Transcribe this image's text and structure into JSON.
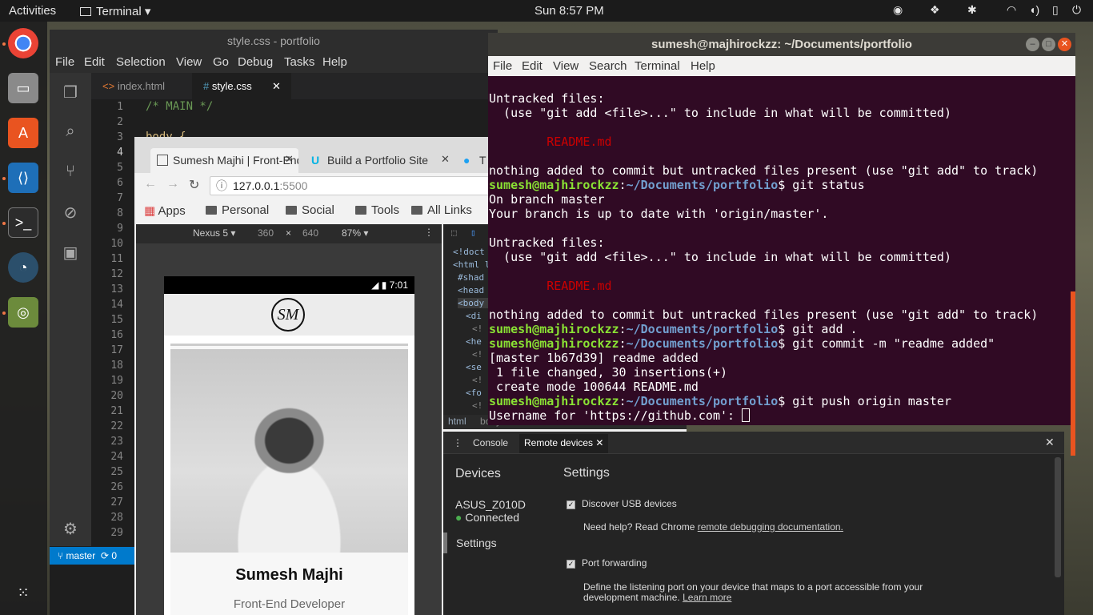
{
  "topbar": {
    "activities": "Activities",
    "app_name": "Terminal",
    "clock": "Sun  8:57 PM"
  },
  "dock": {
    "apps": [
      "chrome",
      "files",
      "software",
      "vscode",
      "terminal",
      "disk-usage",
      "image-viewer"
    ]
  },
  "vscode": {
    "title": "style.css - portfolio",
    "menu": [
      "File",
      "Edit",
      "Selection",
      "View",
      "Go",
      "Debug",
      "Tasks",
      "Help"
    ],
    "tabs": [
      {
        "label": "index.html",
        "active": false
      },
      {
        "label": "style.css",
        "active": true
      }
    ],
    "line_numbers": [
      "1",
      "2",
      "3",
      "4",
      "5",
      "6",
      "7",
      "8",
      "9",
      "10",
      "11",
      "12",
      "13",
      "14",
      "15",
      "16",
      "17",
      "18",
      "19",
      "20",
      "21",
      "22",
      "23",
      "24",
      "25",
      "26",
      "27",
      "28",
      "29"
    ],
    "code_line1": "/* MAIN */",
    "code_line3": "body {",
    "branch": "master",
    "sync": "0"
  },
  "chrome": {
    "tabs": [
      {
        "label": "Sumesh Majhi | Front-End Developer"
      },
      {
        "label": "Build a Portfolio Site"
      },
      {
        "label": "T"
      }
    ],
    "url_host": "127.0.0.1",
    "url_port": ":5500",
    "bookmarks": [
      "Apps",
      "Personal",
      "Social",
      "Tools",
      "All Links"
    ],
    "device": "Nexus 5",
    "width": "360",
    "times": "×",
    "height": "640",
    "zoom": "87%",
    "phone_time": "7:01",
    "logo": "SM",
    "profile_name": "Sumesh Majhi",
    "profile_role": "Front-End Developer",
    "elements_lines": [
      "<!doct",
      "<html l",
      "#shad",
      "<head",
      "<body",
      "<di",
      "<!",
      "<he",
      "<!",
      "<se",
      "<!",
      "<fo",
      "<!"
    ],
    "crumb_html": "html",
    "crumb_body": "body"
  },
  "devtools_drawer": {
    "tabs": [
      "Console",
      "Remote devices"
    ],
    "devices_heading": "Devices",
    "device_name": "ASUS_Z010D",
    "device_status": "Connected",
    "settings_nav": "Settings",
    "settings_heading": "Settings",
    "discover_usb": "Discover USB devices",
    "help_text": "Need help? Read Chrome ",
    "help_link": "remote debugging documentation.",
    "port_forwarding": "Port forwarding",
    "pf_desc": "Define the listening port on your device that maps to a port accessible from your development machine. ",
    "learn_more": "Learn more"
  },
  "terminal": {
    "title": "sumesh@majhirockzz: ~/Documents/portfolio",
    "menu": [
      "File",
      "Edit",
      "View",
      "Search",
      "Terminal",
      "Help"
    ],
    "user": "sumesh@majhirockzz",
    "path": "~/Documents/portfolio",
    "lines": {
      "l1": "Untracked files:",
      "l2": "  (use \"git add <file>...\" to include in what will be committed)",
      "l3": "README.md",
      "l4": "nothing added to commit but untracked files present (use \"git add\" to track)",
      "cmd1": "$ git status",
      "l5": "On branch master",
      "l6": "Your branch is up to date with 'origin/master'.",
      "l7": "Untracked files:",
      "l8": "  (use \"git add <file>...\" to include in what will be committed)",
      "l9": "README.md",
      "l10": "nothing added to commit but untracked files present (use \"git add\" to track)",
      "cmd2": "$ git add .",
      "cmd3": "$ git commit -m \"readme added\"",
      "l11": "[master 1b67d39] readme added",
      "l12": " 1 file changed, 30 insertions(+)",
      "l13": " create mode 100644 README.md",
      "cmd4": "$ git push origin master",
      "l14": "Username for 'https://github.com': "
    }
  },
  "colors": {
    "terminal_bg": "#300a24",
    "ubuntu_orange": "#e95420",
    "vscode_blue": "#007acc"
  }
}
